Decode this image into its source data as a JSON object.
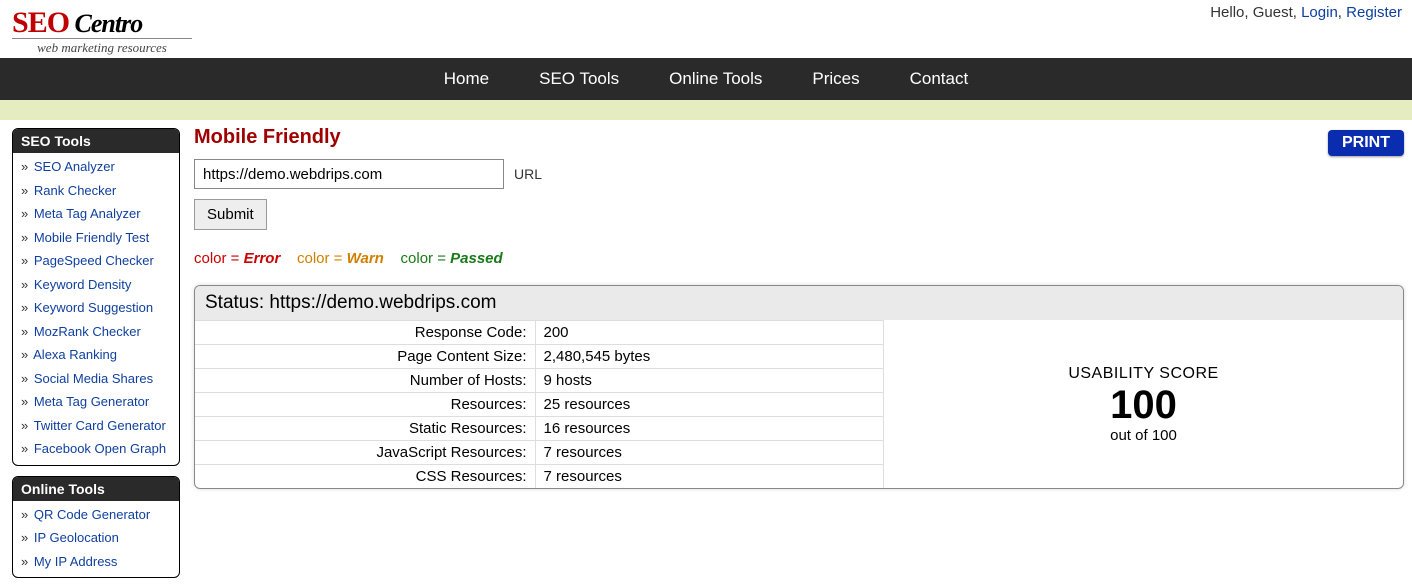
{
  "header": {
    "greeting": "Hello, Guest, ",
    "login": "Login",
    "register": "Register",
    "tagline": "web marketing resources"
  },
  "nav": {
    "home": "Home",
    "seo_tools": "SEO Tools",
    "online_tools": "Online Tools",
    "prices": "Prices",
    "contact": "Contact"
  },
  "sidebar": {
    "seo_title": "SEO Tools",
    "seo_items": [
      "SEO Analyzer",
      "Rank Checker",
      "Meta Tag Analyzer",
      "Mobile Friendly Test",
      "PageSpeed Checker",
      "Keyword Density",
      "Keyword Suggestion",
      "MozRank Checker",
      "Alexa Ranking",
      "Social Media Shares",
      "Meta Tag Generator",
      "Twitter Card Generator",
      "Facebook Open Graph"
    ],
    "online_title": "Online Tools",
    "online_items": [
      "QR Code Generator",
      "IP Geolocation",
      "My IP Address"
    ]
  },
  "page": {
    "title": "Mobile Friendly",
    "print": "PRINT",
    "url_value": "https://demo.webdrips.com",
    "url_label": "URL",
    "submit": "Submit"
  },
  "legend": {
    "color_word": "color",
    "eq": " = ",
    "error": "Error",
    "warn": "Warn",
    "passed": "Passed"
  },
  "status": {
    "prefix": "Status: ",
    "url": "https://demo.webdrips.com",
    "rows": [
      {
        "label": "Response Code:",
        "value": "200"
      },
      {
        "label": "Page Content Size:",
        "value": "2,480,545 bytes"
      },
      {
        "label": "Number of Hosts:",
        "value": "9 hosts"
      },
      {
        "label": "Resources:",
        "value": "25 resources"
      },
      {
        "label": "Static Resources:",
        "value": "16 resources"
      },
      {
        "label": "JavaScript Resources:",
        "value": "7 resources"
      },
      {
        "label": "CSS Resources:",
        "value": "7 resources"
      }
    ],
    "score_title": "USABILITY SCORE",
    "score_value": "100",
    "score_out": "out of 100"
  }
}
